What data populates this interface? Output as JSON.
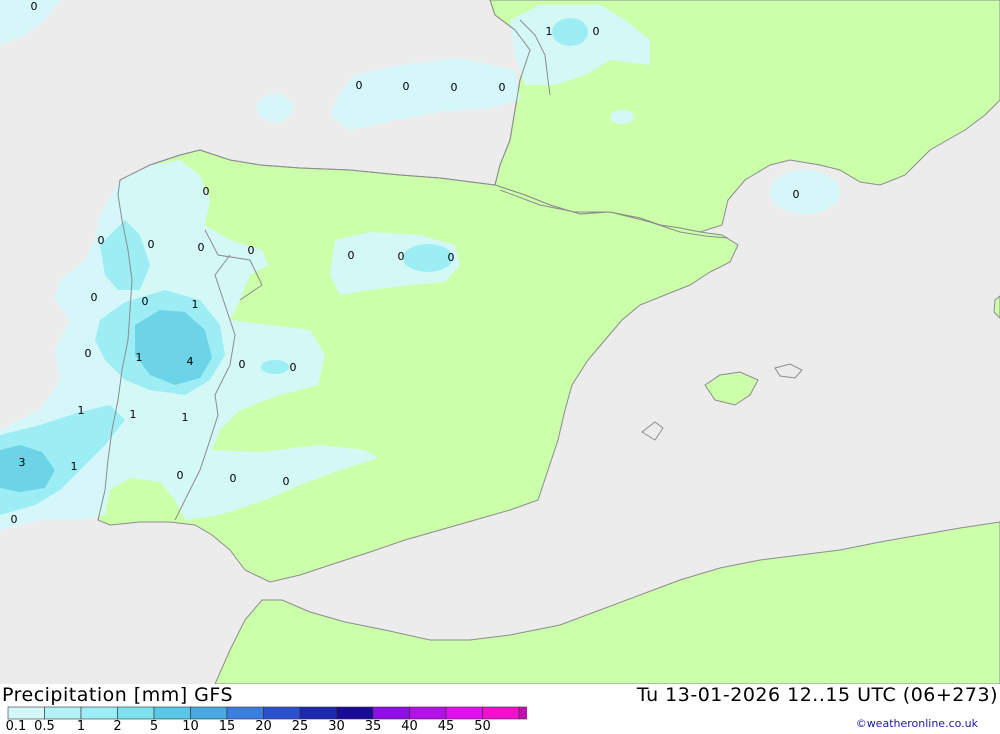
{
  "map": {
    "colors": {
      "sea": "#ececec",
      "land": "#ccffaa",
      "precip_light": "#d4f8fa",
      "precip_mid": "#9ceef4",
      "precip_heavy": "#6cd4e6",
      "coast": "#8c8c8c"
    },
    "values": [
      "0",
      "1",
      "0",
      "0",
      "0",
      "0",
      "0",
      "0",
      "0",
      "0",
      "0",
      "0",
      "0",
      "0",
      "0",
      "0",
      "0",
      "0",
      "1",
      "0",
      "1",
      "4",
      "0",
      "0",
      "1",
      "1",
      "1",
      "3",
      "1",
      "0",
      "0",
      "0",
      "0"
    ]
  },
  "footer": {
    "product": "Precipitation [mm] GFS",
    "timestamp": "Tu 13-01-2026 12..15 UTC (06+273)",
    "credit": "©weatheronline.co.uk",
    "legend": {
      "labels": [
        "0.1",
        "0.5",
        "1",
        "2",
        "5",
        "10",
        "15",
        "20",
        "25",
        "30",
        "35",
        "40",
        "45",
        "50"
      ],
      "colors": [
        "#d4f8fa",
        "#b4f2f6",
        "#9ceef4",
        "#7ce2ee",
        "#58c8e6",
        "#48a8e0",
        "#3a7ee0",
        "#2c50d0",
        "#1c28b0",
        "#1a0a98",
        "#8e10e6",
        "#b410e8",
        "#e010f0",
        "#f010d0",
        "#c010b0"
      ]
    }
  }
}
